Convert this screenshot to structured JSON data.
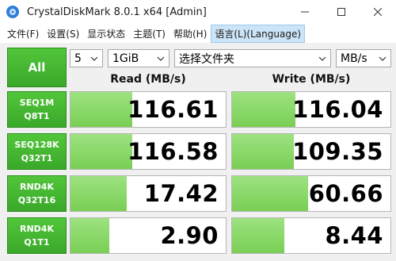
{
  "window": {
    "title": "CrystalDiskMark 8.0.1 x64 [Admin]"
  },
  "menu": [
    {
      "label": "文件(F)"
    },
    {
      "label": "设置(S)"
    },
    {
      "label": "显示状态"
    },
    {
      "label": "主题(T)"
    },
    {
      "label": "帮助(H)"
    },
    {
      "label": "语言(L)(Language)"
    }
  ],
  "controls": {
    "all_label": "All",
    "count": "5",
    "size": "1GiB",
    "target": "选择文件夹",
    "unit": "MB/s"
  },
  "columns": {
    "read": "Read (MB/s)",
    "write": "Write (MB/s)"
  },
  "rows": [
    {
      "label1": "SEQ1M",
      "label2": "Q8T1",
      "read": "116.61",
      "write": "116.04",
      "read_level": 0.4,
      "write_level": 0.4
    },
    {
      "label1": "SEQ128K",
      "label2": "Q32T1",
      "read": "116.58",
      "write": "109.35",
      "read_level": 0.4,
      "write_level": 0.39
    },
    {
      "label1": "RND4K",
      "label2": "Q32T16",
      "read": "17.42",
      "write": "60.66",
      "read_level": 0.36,
      "write_level": 0.48
    },
    {
      "label1": "RND4K",
      "label2": "Q1T1",
      "read": "2.90",
      "write": "8.44",
      "read_level": 0.25,
      "write_level": 0.33
    }
  ],
  "colors": {
    "green": "#3aa82a",
    "bar": "#8fdc70",
    "selected_menu": "#cce4f7"
  },
  "icons": [
    "app-icon",
    "minimize-icon",
    "maximize-icon",
    "close-icon",
    "chevron-down-icon"
  ]
}
